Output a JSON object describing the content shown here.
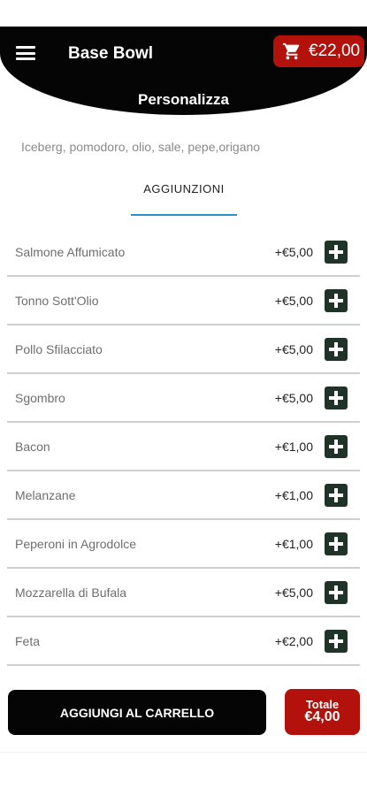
{
  "header": {
    "app_title": "Base Bowl",
    "cart_total": "€22,00",
    "page_title": "Personalizza"
  },
  "ingredients": "Iceberg, pomodoro, olio, sale, pepe,origano",
  "tab": {
    "label": "AGGIUNZIONI"
  },
  "additions": [
    {
      "name": "Salmone Affumicato",
      "price": "+€5,00"
    },
    {
      "name": "Tonno Sott'Olio",
      "price": "+€5,00"
    },
    {
      "name": "Pollo Sfilacciato",
      "price": "+€5,00"
    },
    {
      "name": "Sgombro",
      "price": "+€5,00"
    },
    {
      "name": "Bacon",
      "price": "+€1,00"
    },
    {
      "name": "Melanzane",
      "price": "+€1,00"
    },
    {
      "name": "Peperoni in Agrodolce",
      "price": "+€1,00"
    },
    {
      "name": "Mozzarella di Bufala",
      "price": "+€5,00"
    },
    {
      "name": "Feta",
      "price": "+€2,00"
    }
  ],
  "footer": {
    "add_to_cart_label": "AGGIUNGI AL CARRELLO",
    "total_label": "Totale",
    "total_value": "€4,00"
  },
  "icons": {
    "menu": "menu-icon",
    "cart": "shopping-cart-icon",
    "add": "plus-icon"
  },
  "colors": {
    "header_bg": "#050505",
    "accent_red": "#b3120c",
    "add_button": "#1f3328",
    "tab_underline": "#2a8fc4"
  }
}
